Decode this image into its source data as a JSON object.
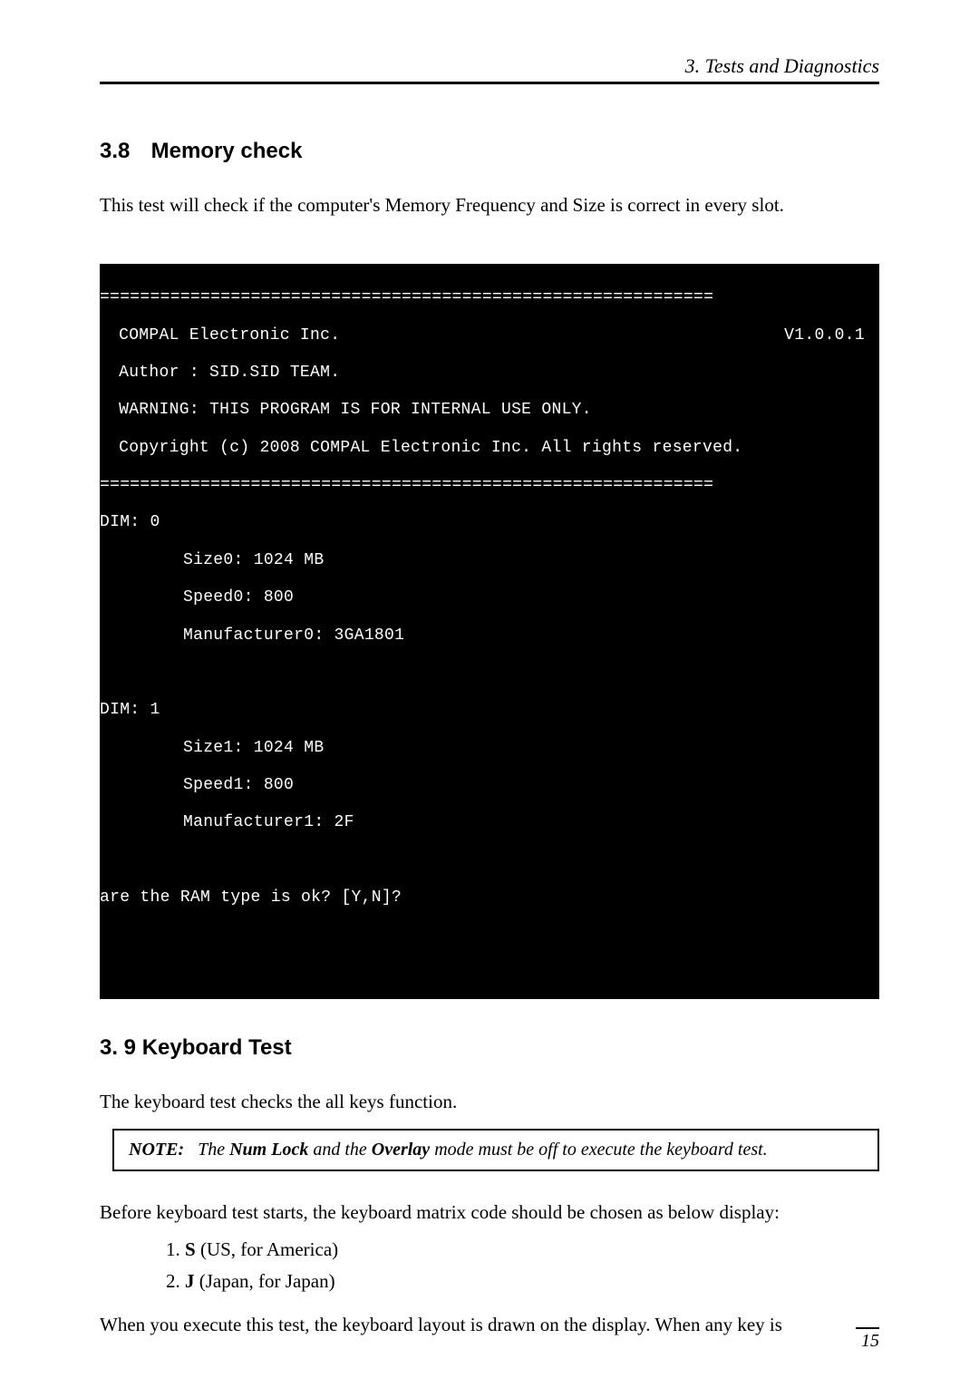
{
  "header": {
    "chapter": "3.  Tests and Diagnostics"
  },
  "section38": {
    "number": "3.8",
    "title": "Memory check",
    "intro": "This test will check if the computer's Memory Frequency and Size is correct in every slot."
  },
  "terminal": {
    "div_top": "=============================================================",
    "company": " COMPAL Electronic Inc.",
    "version": "V1.0.0.1",
    "author": " Author : SID.SID TEAM.",
    "warning": " WARNING: THIS PROGRAM IS FOR INTERNAL USE ONLY.",
    "copyright": " Copyright (c) 2008 COMPAL Electronic Inc. All rights reserved.",
    "div_bot": "=============================================================",
    "dim0": "DIM: 0",
    "size0": "Size0: 1024 MB",
    "speed0": "Speed0: 800",
    "mfr0": "Manufacturer0: 3GA1801",
    "dim1": "DIM: 1",
    "size1": "Size1: 1024 MB",
    "speed1": "Speed1: 800",
    "mfr1": "Manufacturer1: 2F",
    "prompt": "are the RAM type is ok? [Y,N]?"
  },
  "section39": {
    "number": "3. 9",
    "title": "Keyboard Test",
    "intro": "The keyboard test checks the all keys function.",
    "note_label": "NOTE:",
    "note_p1": "The ",
    "note_kw1": "Num Lock",
    "note_p2": " and the ",
    "note_kw2": "Overlay",
    "note_p3": " mode must be off to execute the keyboard test.",
    "before": "Before keyboard test starts, the keyboard matrix code should be chosen as below display:",
    "opt1_kbd": "S",
    "opt1_txt": " (US, for America)",
    "opt2_kbd": "J",
    "opt2_txt": " (Japan, for Japan)",
    "exec": "When you execute this test, the keyboard layout is drawn on the display. When any key is"
  },
  "footer": {
    "page": "15"
  }
}
